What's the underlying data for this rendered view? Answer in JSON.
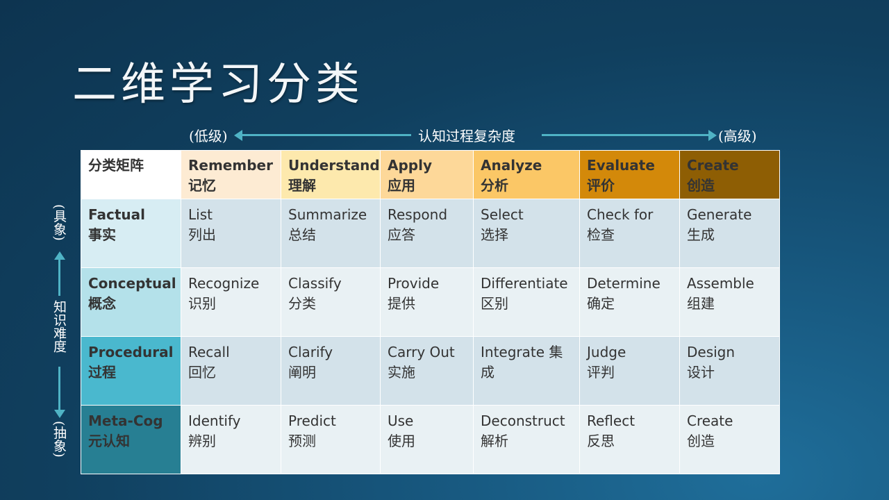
{
  "slide": {
    "title": "二维学习分类"
  },
  "top_axis": {
    "low": "(低级)",
    "label": "认知过程复杂度",
    "high": "(高级)"
  },
  "left_axis": {
    "top": "(具象)",
    "label": "知识难度",
    "bottom": "(抽象)"
  },
  "matrix": {
    "corner": "分类矩阵",
    "columns": [
      {
        "en": "Remember",
        "zh": "记忆",
        "color": "#fdebd3"
      },
      {
        "en": "Understand",
        "zh": "理解",
        "color": "#fde9ad"
      },
      {
        "en": "Apply",
        "zh": "应用",
        "color": "#fdd899"
      },
      {
        "en": "Analyze",
        "zh": "分析",
        "color": "#fbc766"
      },
      {
        "en": "Evaluate",
        "zh": "评价",
        "color": "#d3890a"
      },
      {
        "en": "Create",
        "zh": "创造",
        "color": "#8e5e04"
      }
    ],
    "rows": [
      {
        "en": "Factual",
        "zh": "事实",
        "color": "#d7edf3",
        "cell_color": "#d3e2ea",
        "cells": [
          {
            "en": "List",
            "zh": "列出"
          },
          {
            "en": "Summarize",
            "zh": "总结"
          },
          {
            "en": "Respond",
            "zh": "应答"
          },
          {
            "en": "Select",
            "zh": "选择"
          },
          {
            "en": "Check for",
            "zh": "检查"
          },
          {
            "en": "Generate",
            "zh": "生成"
          }
        ]
      },
      {
        "en": "Conceptual",
        "zh": "概念",
        "color": "#b4e1ea",
        "cell_color": "#e9f1f4",
        "cells": [
          {
            "en": "Recognize",
            "zh": "识别"
          },
          {
            "en": "Classify",
            "zh": "分类"
          },
          {
            "en": "Provide",
            "zh": "提供"
          },
          {
            "en": "Differentiate",
            "zh": "区别"
          },
          {
            "en": "Determine",
            "zh": "确定"
          },
          {
            "en": "Assemble",
            "zh": "组建"
          }
        ]
      },
      {
        "en": "Procedural",
        "zh": "过程",
        "color": "#4ab8ce",
        "cell_color": "#d3e2ea",
        "cells": [
          {
            "en": "Recall",
            "zh": "回忆"
          },
          {
            "en": "Clarify",
            "zh": "阐明"
          },
          {
            "en": "Carry Out",
            "zh": "实施"
          },
          {
            "en": "Integrate 集",
            "zh": "成"
          },
          {
            "en": "Judge",
            "zh": "评判"
          },
          {
            "en": "Design",
            "zh": "设计"
          }
        ]
      },
      {
        "en": "Meta-Cog",
        "zh": "元认知",
        "color": "#277f93",
        "cell_color": "#e9f1f4",
        "cells": [
          {
            "en": "Identify",
            "zh": "辨别"
          },
          {
            "en": "Predict",
            "zh": "预测"
          },
          {
            "en": "Use",
            "zh": "使用"
          },
          {
            "en": "Deconstruct",
            "zh": "解析"
          },
          {
            "en": "Reflect",
            "zh": "反思"
          },
          {
            "en": "Create",
            "zh": "创造"
          }
        ]
      }
    ]
  }
}
